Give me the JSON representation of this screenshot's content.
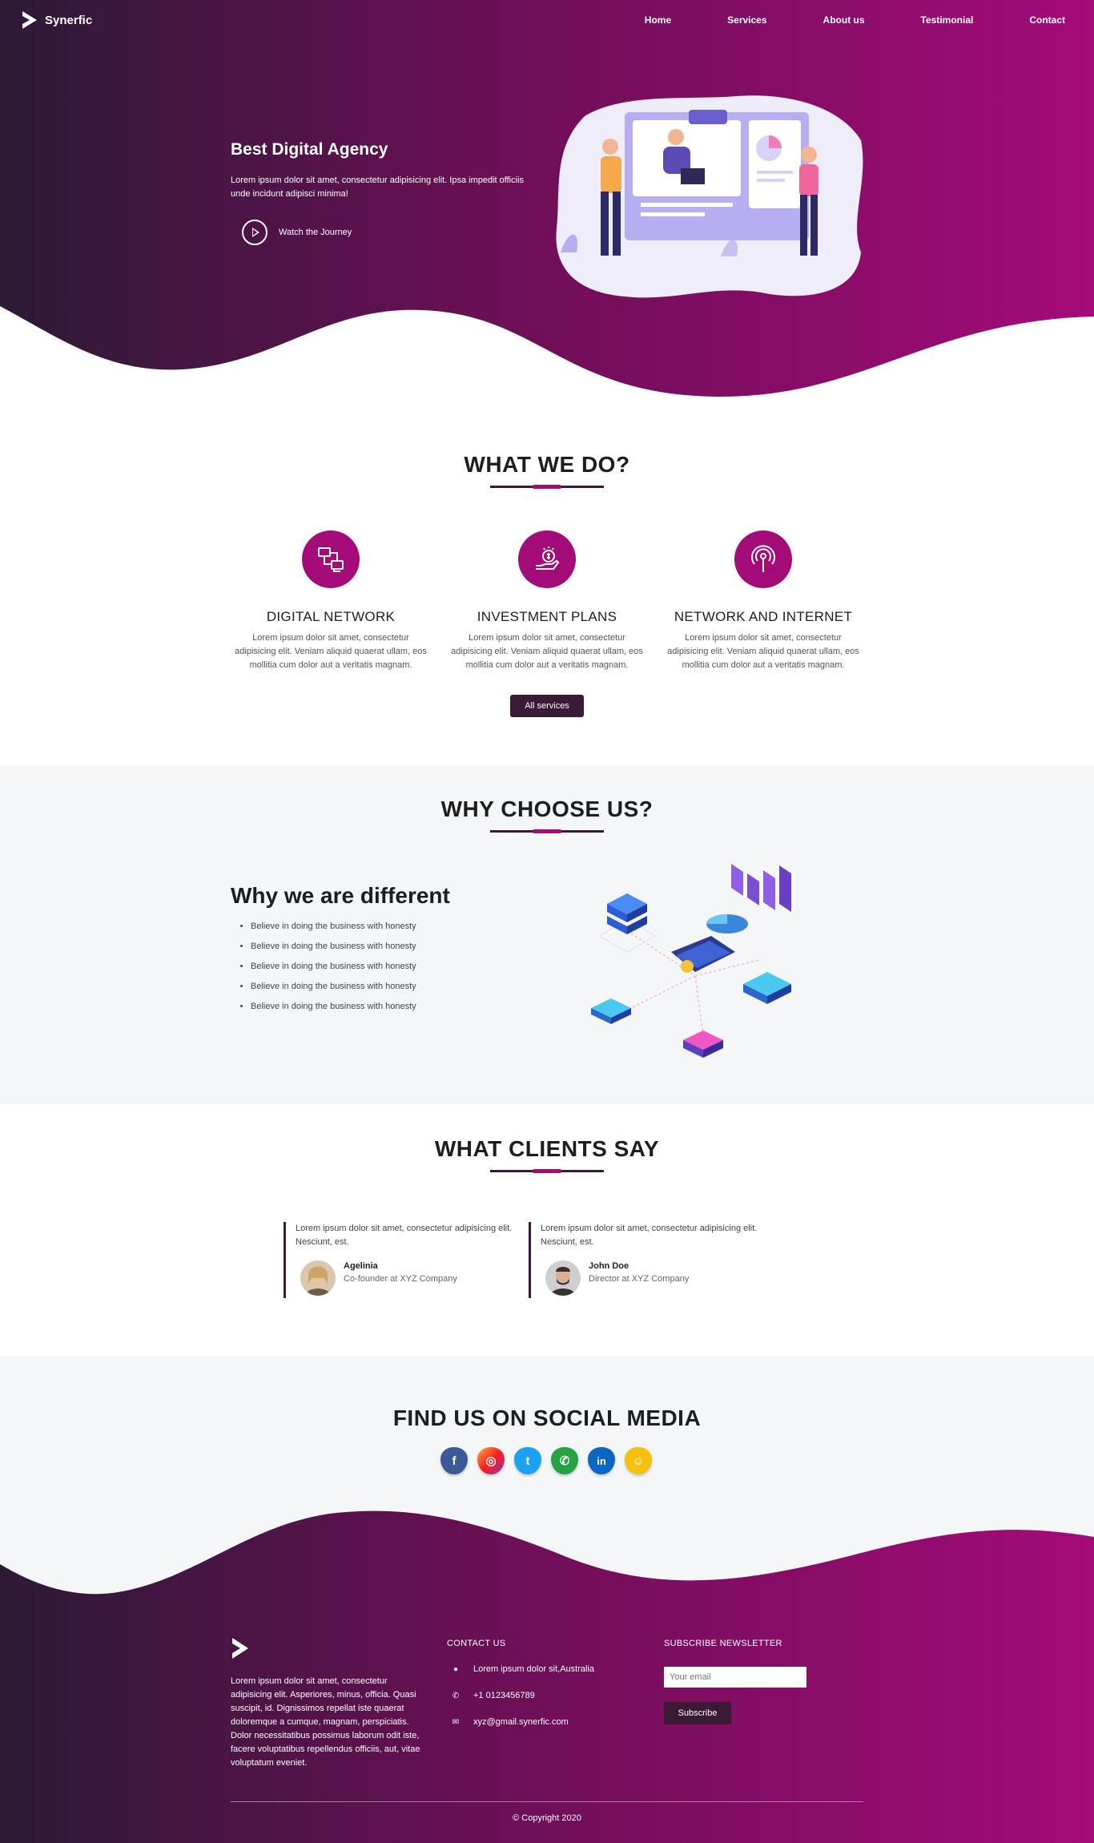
{
  "brand": {
    "name": "Synerfic"
  },
  "nav": {
    "items": [
      "Home",
      "Services",
      "About us",
      "Testimonial",
      "Contact"
    ]
  },
  "hero": {
    "title": "Best Digital Agency",
    "text": "Lorem ipsum dolor sit amet, consectetur adipisicing elit. Ipsa impedit officiis unde incidunt adipisci minima!",
    "cta": "Watch the Journey"
  },
  "services": {
    "title": "WHAT WE DO?",
    "items": [
      {
        "title": "DIGITAL NETWORK",
        "text": "Lorem ipsum dolor sit amet, consectetur adipisicing elit. Veniam aliquid quaerat ullam, eos mollitia cum dolor aut a veritatis magnam.",
        "icon": "network-computers-icon"
      },
      {
        "title": "INVESTMENT PLANS",
        "text": "Lorem ipsum dolor sit amet, consectetur adipisicing elit. Veniam aliquid quaerat ullam, eos mollitia cum dolor aut a veritatis magnam.",
        "icon": "hand-coin-icon"
      },
      {
        "title": "NETWORK AND INTERNET",
        "text": "Lorem ipsum dolor sit amet, consectetur adipisicing elit. Veniam aliquid quaerat ullam, eos mollitia cum dolor aut a veritatis magnam.",
        "icon": "broadcast-antenna-icon"
      }
    ],
    "button": "All services"
  },
  "why": {
    "title": "WHY CHOOSE US?",
    "heading": "Why we are different",
    "points": [
      "Believe in doing the business with honesty",
      "Believe in doing the business with honesty",
      "Believe in doing the business with honesty",
      "Believe in doing the business with honesty",
      "Believe in doing the business with honesty"
    ]
  },
  "clients": {
    "title": "WHAT CLIENTS SAY",
    "items": [
      {
        "text": "Lorem ipsum dolor sit amet, consectetur adipisicing elit. Nesciunt, est.",
        "name": "Agelinia",
        "role": "Co-founder at XYZ Company"
      },
      {
        "text": "Lorem ipsum dolor sit amet, consectetur adipisicing elit. Nesciunt, est.",
        "name": "John Doe",
        "role": "Director at XYZ Company"
      }
    ]
  },
  "social": {
    "title": "FIND US ON SOCIAL MEDIA",
    "items": [
      {
        "icon": "facebook-icon",
        "glyph": "f",
        "color": "#3b5998"
      },
      {
        "icon": "instagram-icon",
        "glyph": "◎",
        "color": "#d6249f"
      },
      {
        "icon": "twitter-icon",
        "glyph": "t",
        "color": "#1da1f2"
      },
      {
        "icon": "whatsapp-icon",
        "glyph": "✆",
        "color": "#25a244"
      },
      {
        "icon": "linkedin-icon",
        "glyph": "in",
        "color": "#0a66c2"
      },
      {
        "icon": "snapchat-icon",
        "glyph": "☺",
        "color": "#f4c20d"
      }
    ]
  },
  "footer": {
    "about": "Lorem ipsum dolor sit amet, consectetur adipisicing elit. Asperiores, minus, officia. Quasi suscipit, id. Dignissimos repellat iste quaerat doloremque a cumque, magnam, perspiciatis. Dolor necessitatibus possimus laborum odit iste, facere voluptatibus repellendus officiis, aut, vitae voluptatum eveniet.",
    "contact_title": "CONTACT US",
    "address": "Lorem ipsum dolor sit,Australia",
    "phone": "+1 0123456789",
    "email": "xyz@gmail.synerfic.com",
    "newsletter_title": "SUBSCRIBE NEWSLETTER",
    "email_placeholder": "Your email",
    "subscribe": "Subscribe",
    "copyright": "© Copyright 2020"
  },
  "colors": {
    "primary": "#a30b79",
    "dark": "#3b1a36",
    "gradient_start": "#2c1a35",
    "light_bg": "#f5f6f8"
  }
}
